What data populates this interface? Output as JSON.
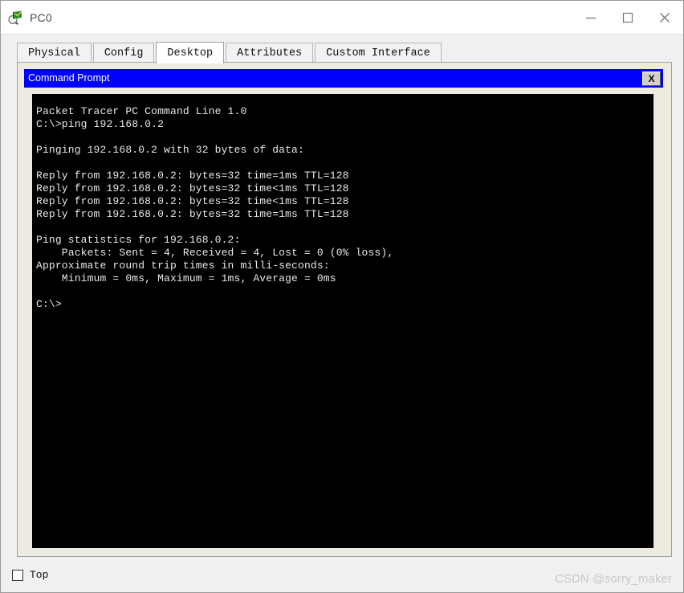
{
  "window": {
    "title": "PC0",
    "icon": "packet-tracer-device-icon",
    "controls": {
      "minimize": "minimize-icon",
      "maximize": "maximize-icon",
      "close": "close-icon"
    }
  },
  "tabs": [
    {
      "label": "Physical",
      "active": false
    },
    {
      "label": "Config",
      "active": false
    },
    {
      "label": "Desktop",
      "active": true
    },
    {
      "label": "Attributes",
      "active": false
    },
    {
      "label": "Custom Interface",
      "active": false
    }
  ],
  "command_prompt": {
    "title": "Command Prompt",
    "close_label": "X",
    "titlebar_color": "#0000FF",
    "background_color": "#000000",
    "text_color": "#E8E8E8",
    "lines": [
      "Packet Tracer PC Command Line 1.0",
      "C:\\>ping 192.168.0.2",
      "",
      "Pinging 192.168.0.2 with 32 bytes of data:",
      "",
      "Reply from 192.168.0.2: bytes=32 time=1ms TTL=128",
      "Reply from 192.168.0.2: bytes=32 time<1ms TTL=128",
      "Reply from 192.168.0.2: bytes=32 time<1ms TTL=128",
      "Reply from 192.168.0.2: bytes=32 time=1ms TTL=128",
      "",
      "Ping statistics for 192.168.0.2:",
      "    Packets: Sent = 4, Received = 4, Lost = 0 (0% loss),",
      "Approximate round trip times in milli-seconds:",
      "    Minimum = 0ms, Maximum = 1ms, Average = 0ms",
      "",
      "C:\\>"
    ]
  },
  "footer": {
    "top_checkbox_label": "Top",
    "top_checked": false,
    "watermark": "CSDN @sorry_maker"
  }
}
